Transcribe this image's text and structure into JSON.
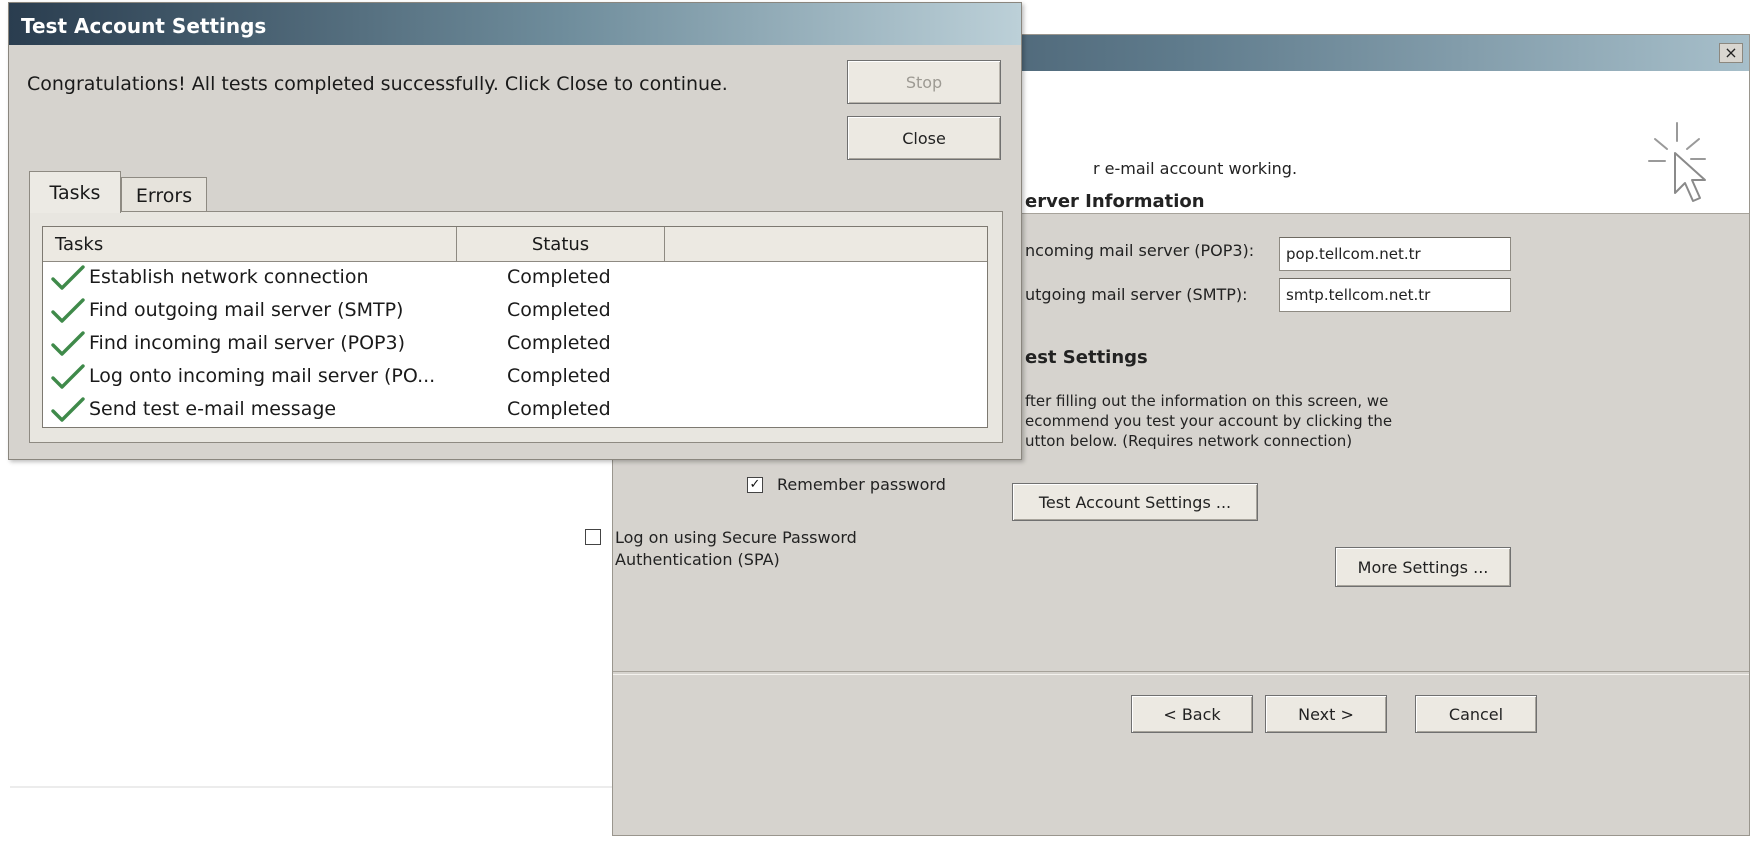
{
  "background_window": {
    "close_glyph": "×",
    "banner_text": "r e-mail account working.",
    "server_info": {
      "heading": "erver Information",
      "incoming_label": "ncoming mail server (POP3):",
      "incoming_value": "pop.tellcom.net.tr",
      "outgoing_label": "utgoing mail server (SMTP):",
      "outgoing_value": "smtp.tellcom.net.tr"
    },
    "test_settings": {
      "heading": "est Settings",
      "line1": "fter filling out the information on this screen, we",
      "line2": "ecommend you test your account by clicking the",
      "line3": "utton below. (Requires network connection)",
      "button_label": "Test Account Settings ..."
    },
    "remember_password": {
      "label": "Remember password",
      "checked": true,
      "mark": "✓"
    },
    "spa": {
      "label_line1": "Log on using Secure Password",
      "label_line2": "Authentication (SPA)",
      "checked": false
    },
    "more_settings_label": "More Settings ...",
    "back_label": "< Back",
    "next_label": "Next >",
    "cancel_label": "Cancel"
  },
  "dialog": {
    "title": "Test Account Settings",
    "message": "Congratulations! All tests completed successfully. Click Close to continue.",
    "stop_label": "Stop",
    "close_label": "Close",
    "tabs": [
      {
        "label": "Tasks",
        "active": true
      },
      {
        "label": "Errors",
        "active": false
      }
    ],
    "columns": {
      "tasks": "Tasks",
      "status": "Status",
      "extra": ""
    },
    "rows": [
      {
        "task": "Establish network connection",
        "status": "Completed"
      },
      {
        "task": "Find outgoing mail server (SMTP)",
        "status": "Completed"
      },
      {
        "task": "Find incoming mail server (POP3)",
        "status": "Completed"
      },
      {
        "task": "Log onto incoming mail server (PO...",
        "status": "Completed"
      },
      {
        "task": "Send test e-mail message",
        "status": "Completed"
      }
    ],
    "check_color": "#3f8a4a"
  }
}
